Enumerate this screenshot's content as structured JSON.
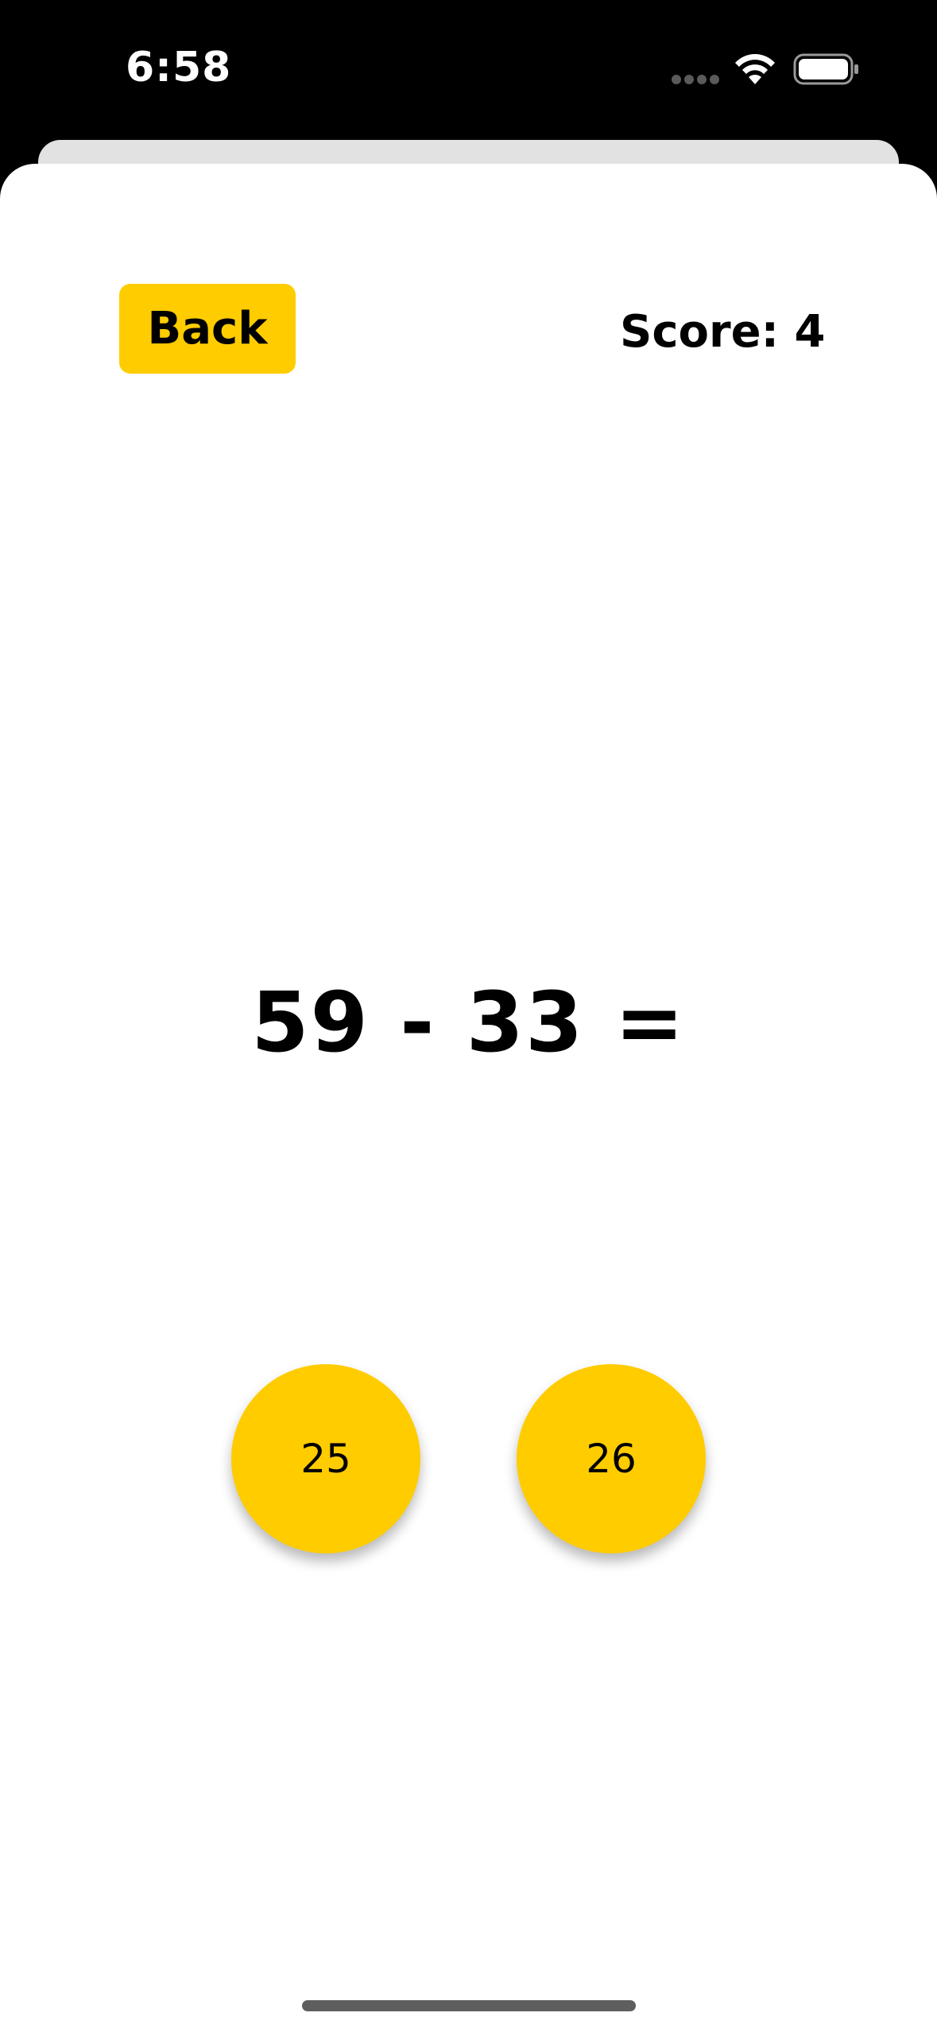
{
  "status_bar": {
    "time": "6:58",
    "icons": [
      "signal-dots-icon",
      "wifi-icon",
      "battery-icon"
    ]
  },
  "header": {
    "back_label": "Back",
    "score_label": "Score: 4"
  },
  "quiz": {
    "question": "59 - 33 =",
    "answers": [
      "25",
      "26"
    ]
  },
  "colors": {
    "accent": "#ffcc00",
    "background": "#ffffff",
    "status_bar_bg": "#000000",
    "text": "#000000"
  }
}
